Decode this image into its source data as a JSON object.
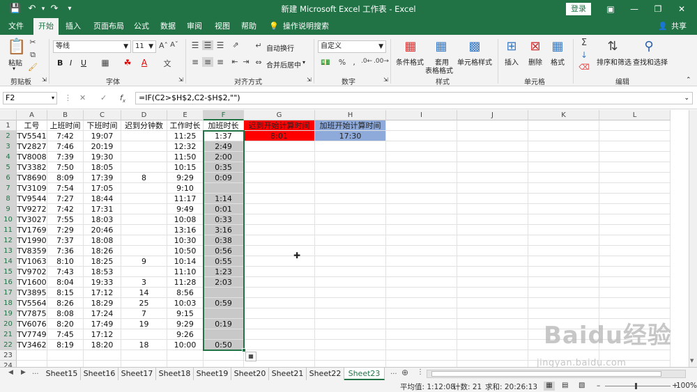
{
  "window": {
    "title": "新建 Microsoft Excel 工作表 - Excel",
    "login": "登录"
  },
  "ribbon_tabs": [
    "文件",
    "开始",
    "插入",
    "页面布局",
    "公式",
    "数据",
    "审阅",
    "视图",
    "帮助",
    "操作说明搜索"
  ],
  "share": "共享",
  "ribbon": {
    "clipboard": {
      "label": "剪贴板",
      "paste": "粘贴"
    },
    "font": {
      "label": "字体",
      "name": "等线",
      "size": "11",
      "bold": "B",
      "italic": "I",
      "underline": "U"
    },
    "align": {
      "label": "对齐方式",
      "wrap": "自动换行",
      "merge": "合并后居中"
    },
    "number": {
      "label": "数字",
      "format": "自定义"
    },
    "styles": {
      "label": "样式",
      "cond": "条件格式",
      "table": "套用",
      "table2": "表格格式",
      "cell": "单元格样式"
    },
    "cells": {
      "label": "单元格",
      "insert": "插入",
      "delete": "删除",
      "format": "格式"
    },
    "edit": {
      "label": "编辑",
      "sort": "排序和筛选",
      "find": "查找和选择"
    }
  },
  "formula_bar": {
    "name_box": "F2",
    "formula": "=IF(C2>$H$2,C2-$H$2,\"\")"
  },
  "grid": {
    "columns": [
      "A",
      "B",
      "C",
      "D",
      "E",
      "F",
      "G",
      "H",
      "I",
      "J",
      "K",
      "L"
    ],
    "rows": [
      [
        "工号",
        "上班时间",
        "下班时间",
        "迟到分钟数",
        "工作时长",
        "加班时长",
        "迟到开始计算时间",
        "加班开始计算时间"
      ],
      [
        "TV5541",
        "7:42",
        "19:07",
        "",
        "11:25",
        "1:37",
        "8:01",
        "17:30"
      ],
      [
        "TV2827",
        "7:46",
        "20:19",
        "",
        "12:32",
        "2:49",
        "",
        ""
      ],
      [
        "TV8008",
        "7:39",
        "19:30",
        "",
        "11:50",
        "2:00",
        "",
        ""
      ],
      [
        "TV3382",
        "7:50",
        "18:05",
        "",
        "10:15",
        "0:35",
        "",
        ""
      ],
      [
        "TV8690",
        "8:09",
        "17:39",
        "8",
        "9:29",
        "0:09",
        "",
        ""
      ],
      [
        "TV3109",
        "7:54",
        "17:05",
        "",
        "9:10",
        "",
        "",
        ""
      ],
      [
        "TV9544",
        "7:27",
        "18:44",
        "",
        "11:17",
        "1:14",
        "",
        ""
      ],
      [
        "TV9272",
        "7:42",
        "17:31",
        "",
        "9:49",
        "0:01",
        "",
        ""
      ],
      [
        "TV3027",
        "7:55",
        "18:03",
        "",
        "10:08",
        "0:33",
        "",
        ""
      ],
      [
        "TV1769",
        "7:29",
        "20:46",
        "",
        "13:16",
        "3:16",
        "",
        ""
      ],
      [
        "TV1990",
        "7:37",
        "18:08",
        "",
        "10:30",
        "0:38",
        "",
        ""
      ],
      [
        "TV8359",
        "7:36",
        "18:26",
        "",
        "10:50",
        "0:56",
        "",
        ""
      ],
      [
        "TV1063",
        "8:10",
        "18:25",
        "9",
        "10:14",
        "0:55",
        "",
        ""
      ],
      [
        "TV9702",
        "7:43",
        "18:53",
        "",
        "11:10",
        "1:23",
        "",
        ""
      ],
      [
        "TV1600",
        "8:04",
        "19:33",
        "3",
        "11:28",
        "2:03",
        "",
        ""
      ],
      [
        "TV3895",
        "8:15",
        "17:12",
        "14",
        "8:56",
        "",
        "",
        ""
      ],
      [
        "TV5564",
        "8:26",
        "18:29",
        "25",
        "10:03",
        "0:59",
        "",
        ""
      ],
      [
        "TV7875",
        "8:08",
        "17:24",
        "7",
        "9:15",
        "",
        "",
        ""
      ],
      [
        "TV6076",
        "8:20",
        "17:49",
        "19",
        "9:29",
        "0:19",
        "",
        ""
      ],
      [
        "TV7749",
        "7:45",
        "17:12",
        "",
        "9:26",
        "",
        "",
        ""
      ],
      [
        "TV3462",
        "8:19",
        "18:20",
        "18",
        "10:00",
        "0:50",
        "",
        ""
      ],
      [
        "",
        "",
        "",
        "",
        "",
        "",
        "",
        ""
      ],
      [
        "",
        "",
        "",
        "",
        "",
        "",
        "",
        ""
      ]
    ]
  },
  "sheets": [
    "Sheet15",
    "Sheet16",
    "Sheet17",
    "Sheet18",
    "Sheet19",
    "Sheet20",
    "Sheet21",
    "Sheet22",
    "Sheet23"
  ],
  "sheet_more": "...",
  "status": {
    "avg": "平均值: 1:12:08",
    "count": "计数: 21",
    "sum": "求和: 20:26:13",
    "zoom": "100%"
  },
  "watermark": {
    "text": "Baidu经验",
    "url": "jingyan.baidu.com"
  },
  "colors": {
    "excel_green": "#217346",
    "header_red": "#ff0000",
    "header_blue": "#8eaadb"
  }
}
